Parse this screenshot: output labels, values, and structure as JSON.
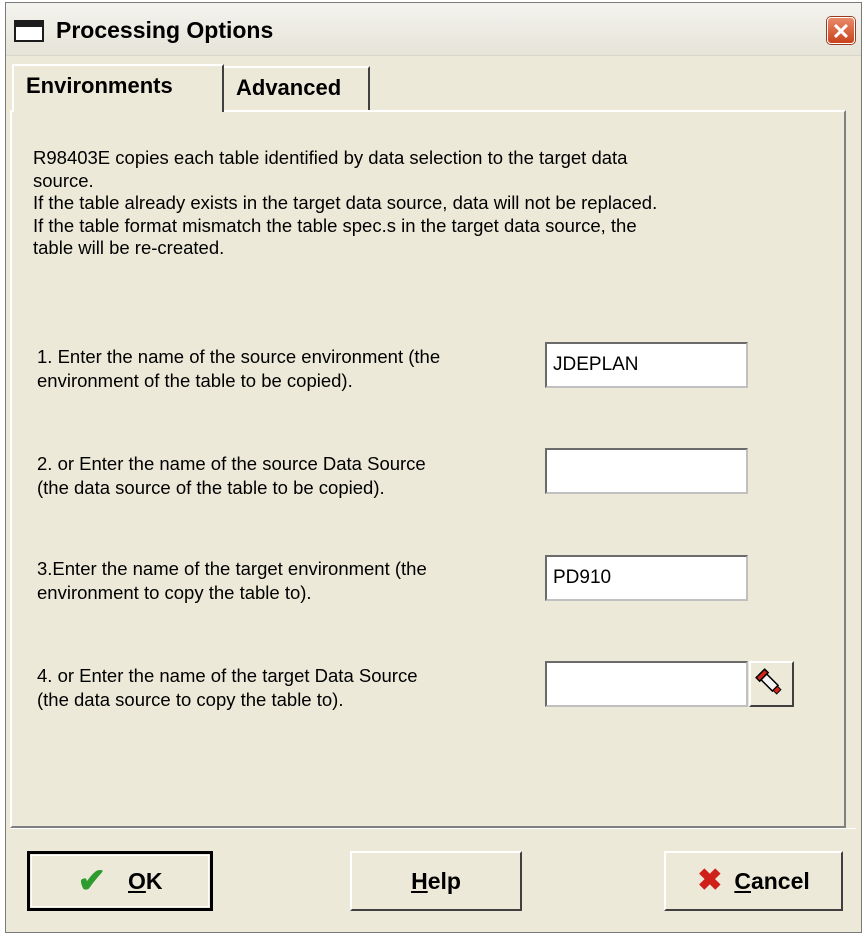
{
  "window": {
    "title": "Processing Options",
    "close_label": "✕"
  },
  "tabs": [
    {
      "label": "Environments",
      "active": true
    },
    {
      "label": "Advanced",
      "active": false
    }
  ],
  "description": [
    "R98403E copies each table identified by data selection to the target data",
    "source.",
    "If the table already exists in the target data source, data will not be replaced.",
    "If the table format mismatch the table spec.s in the target data source, the",
    "table will be re-created."
  ],
  "options": [
    {
      "label_line1": "1. Enter the name of the source environment (the",
      "label_line2": "environment of the table to be copied).",
      "value": "JDEPLAN"
    },
    {
      "label_line1": "2. or Enter the name of the source Data Source",
      "label_line2": "(the data source of the table to be copied).",
      "value": ""
    },
    {
      "label_line1": "3.Enter the name of the target environment (the",
      "label_line2": "environment to copy the table to).",
      "value": "PD910"
    },
    {
      "label_line1": "4. or Enter the name of the target Data Source",
      "label_line2": "(the data source to copy the table to).",
      "value": ""
    }
  ],
  "buttons": {
    "ok": {
      "mnemonic": "O",
      "rest": "K"
    },
    "help": {
      "mnemonic": "H",
      "rest": "elp"
    },
    "cancel": {
      "mnemonic": "C",
      "rest": "ancel"
    }
  },
  "icons": {
    "check": "✔",
    "x": "✖"
  }
}
